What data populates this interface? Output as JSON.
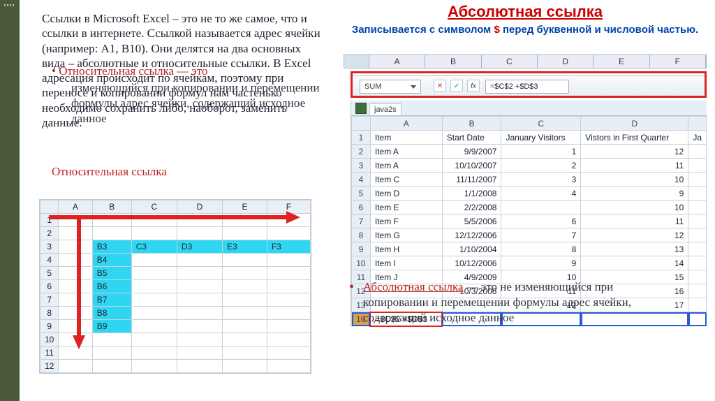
{
  "leftBar": {},
  "mainText": "Ссылки в Microsoft Excel – это не то же самое, что и ссылки в интернете. Ссылкой называется адрес ячейки (например: А1, В10). Они делятся на два основных вида – абсолютные и относительные ссылки. В Excel адресация происходит по ячейкам, поэтому при переносе и копировании формул нам частенько необходимо сохранить либо, наоборот, заменить данные.",
  "relTitle": "Относительная ссылка",
  "relBody": "изменяющийся при копировании и перемещении формулы адрес ячейки, содержащий исходное данное",
  "relTitle2": "Относительная ссылка",
  "abs": {
    "title": "Абсолютная ссылка",
    "sub_pre": "Записывается с символом ",
    "sub_sym": "$",
    "sub_post": " перед буквенной и числовой частью."
  },
  "miniCols": [
    "A",
    "B",
    "C",
    "D",
    "E",
    "F"
  ],
  "nameBox": "SUM",
  "formula": "=$C$2 +$D$3",
  "tabName": "java2s",
  "rightHeaders": [
    "Item",
    "Start Date",
    "January Visitors",
    "Vistors in First Quarter",
    "Ja"
  ],
  "rightRows": [
    {
      "n": 2,
      "item": "Item A",
      "date": "9/9/2007",
      "v1": "1",
      "v2": "12"
    },
    {
      "n": 3,
      "item": "Item A",
      "date": "10/10/2007",
      "v1": "2",
      "v2": "11"
    },
    {
      "n": 4,
      "item": "Item C",
      "date": "11/11/2007",
      "v1": "3",
      "v2": "10"
    },
    {
      "n": 5,
      "item": "Item D",
      "date": "1/1/2008",
      "v1": "4",
      "v2": "9"
    },
    {
      "n": 6,
      "item": "Item E",
      "date": "2/2/2008",
      "v1": "",
      "v2": "10"
    },
    {
      "n": 7,
      "item": "Item F",
      "date": "5/5/2006",
      "v1": "6",
      "v2": "11"
    },
    {
      "n": 8,
      "item": "Item G",
      "date": "12/12/2006",
      "v1": "7",
      "v2": "12"
    },
    {
      "n": 9,
      "item": "Item H",
      "date": "1/10/2004",
      "v1": "8",
      "v2": "13"
    },
    {
      "n": 10,
      "item": "Item I",
      "date": "10/12/2006",
      "v1": "9",
      "v2": "14"
    },
    {
      "n": 11,
      "item": "Item J",
      "date": "4/9/2009",
      "v1": "10",
      "v2": "15"
    },
    {
      "n": 12,
      "item": "",
      "date": "10/3/2006",
      "v1": "11",
      "v2": "16"
    },
    {
      "n": 13,
      "item": "",
      "date": "",
      "v1": "12",
      "v2": "17"
    }
  ],
  "selRowLabel": "16",
  "selRowVal": "=$C$2 +$D$3",
  "absBullet": {
    "red": "Абсолютная ссылка",
    "rest": " — это не изменяющийся при копировании и перемещении формулы адрес ячейки, содержащий исходное данное"
  },
  "leftCols": [
    "A",
    "B",
    "C",
    "D",
    "E",
    "F"
  ],
  "leftRows": [
    {
      "n": 1,
      "cells": [
        "",
        "",
        "",
        "",
        "",
        ""
      ]
    },
    {
      "n": 2,
      "cells": [
        "",
        "",
        "",
        "",
        "",
        ""
      ]
    },
    {
      "n": 3,
      "cells": [
        "",
        "B3",
        "C3",
        "D3",
        "E3",
        "F3"
      ],
      "hlRow": true
    },
    {
      "n": 4,
      "cells": [
        "",
        "B4",
        "",
        "",
        "",
        ""
      ]
    },
    {
      "n": 5,
      "cells": [
        "",
        "B5",
        "",
        "",
        "",
        ""
      ]
    },
    {
      "n": 6,
      "cells": [
        "",
        "B6",
        "",
        "",
        "",
        ""
      ]
    },
    {
      "n": 7,
      "cells": [
        "",
        "B7",
        "",
        "",
        "",
        ""
      ]
    },
    {
      "n": 8,
      "cells": [
        "",
        "B8",
        "",
        "",
        "",
        ""
      ]
    },
    {
      "n": 9,
      "cells": [
        "",
        "B9",
        "",
        "",
        "",
        ""
      ]
    },
    {
      "n": 10,
      "cells": [
        "",
        "",
        "",
        "",
        "",
        ""
      ]
    },
    {
      "n": 11,
      "cells": [
        "",
        "",
        "",
        "",
        "",
        ""
      ]
    },
    {
      "n": 12,
      "cells": [
        "",
        "",
        "",
        "",
        "",
        ""
      ]
    }
  ]
}
